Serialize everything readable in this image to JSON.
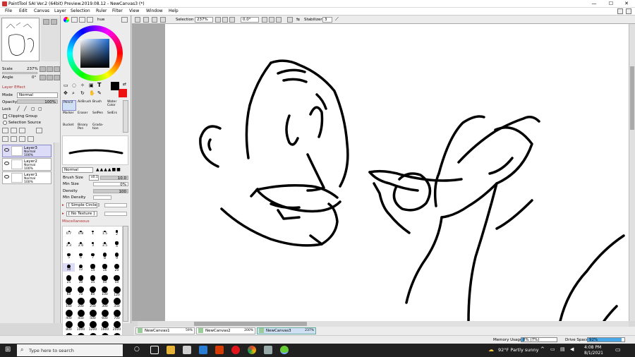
{
  "window": {
    "title": "PaintTool SAI Ver.2 (64bit) Preview.2019.08.12 - NewCanvas3 (*)",
    "minimize": "—",
    "maximize": "☐",
    "close": "✕"
  },
  "menu": [
    "File",
    "Edit",
    "Canvas",
    "Layer",
    "Selection",
    "Ruler",
    "Filter",
    "View",
    "Window",
    "Help"
  ],
  "navigator": {
    "scale_label": "Scale",
    "scale_value": "237%",
    "angle_label": "Angle",
    "angle_value": "0°"
  },
  "layer_effect": {
    "header": "Layer Effect",
    "mode_label": "Mode",
    "mode_value": "Normal",
    "opacity_label": "Opacity",
    "opacity_value": "100%",
    "lock_label": "Lock",
    "clipping_group": "Clipping Group",
    "selection_source": "Selection Source"
  },
  "layers": [
    {
      "name": "Layer3",
      "mode": "Normal",
      "opacity": "100%"
    },
    {
      "name": "Layer2",
      "mode": "Normal",
      "opacity": "100%"
    },
    {
      "name": "Layer1",
      "mode": "Normal",
      "opacity": "100%"
    }
  ],
  "color": {
    "hue_label": "hue",
    "primary": "#000000",
    "secondary": "#ee1111"
  },
  "tools": {
    "text_icon": "T",
    "row1": [
      "Pencil",
      "AirBrush",
      "Brush",
      "Water Color"
    ],
    "row2": [
      "Marker",
      "Eraser",
      "SelPen",
      "SelErs"
    ],
    "row3": [
      "Bucket",
      "Binary Pen",
      "Grada-tion"
    ]
  },
  "brush": {
    "mode_value": "Normal",
    "size_label": "Brush Size",
    "size_mult": "x0.1",
    "size_value": "10.0",
    "min_size_label": "Min Size",
    "min_size_value": "0%",
    "density_label": "Density",
    "density_value": "100",
    "min_density_label": "Min Density",
    "shape_value": "[ Simple Circle ]",
    "texture_value": "[ No Texture ]",
    "misc_label": "Miscellaneous"
  },
  "brush_sizes": [
    "0.7",
    "0.8",
    "1",
    "1.5",
    "2",
    "2.3",
    "2.6",
    "3",
    "3.5",
    "4",
    "5",
    "6",
    "7",
    "8",
    "9",
    "10",
    "12",
    "14",
    "16",
    "20",
    "25",
    "30",
    "35",
    "40",
    "50",
    "60",
    "70",
    "80",
    "100",
    "120",
    "160",
    "200",
    "250",
    "300",
    "350",
    "400",
    "450",
    "500",
    "600",
    "700",
    "800",
    "1000",
    "1200",
    "1600",
    "2000",
    "2500",
    "3000",
    "3500",
    "4000",
    "5000"
  ],
  "canvas_toolbar": {
    "selection_label": "Selection",
    "zoom_value": "237%",
    "angle_value": "0.0°",
    "stabilizer_label": "Stabilizer",
    "stabilizer_value": "3"
  },
  "tabs": [
    {
      "name": "NewCanvas1",
      "zoom": "59%"
    },
    {
      "name": "NewCanvas2",
      "zoom": "200%"
    },
    {
      "name": "NewCanvas3",
      "zoom": "237%"
    }
  ],
  "status": {
    "memory_label": "Memory Usage",
    "memory_value": "8% (7%)",
    "memory_fraction": 0.08,
    "drive_label": "Drive Space",
    "drive_value": "92%",
    "drive_fraction": 0.92
  },
  "taskbar": {
    "search_placeholder": "Type here to search",
    "weather": "92°F  Partly sunny",
    "time": "4:08 PM",
    "date": "8/1/2021"
  }
}
